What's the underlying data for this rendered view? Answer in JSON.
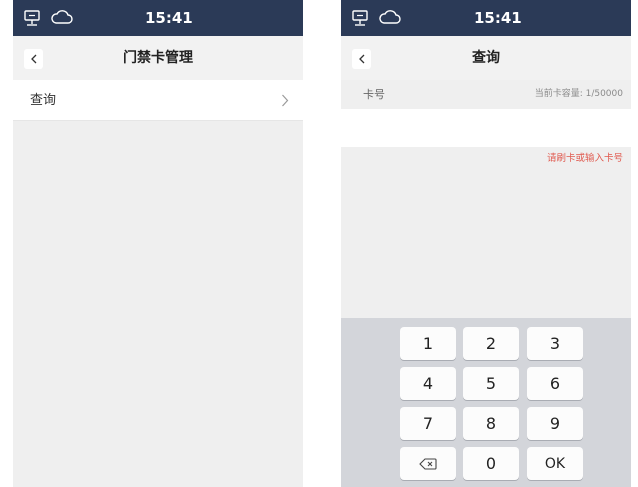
{
  "colors": {
    "status_bar": "#2b3a57",
    "background": "#efefef",
    "hint_red": "#e05a4f",
    "keypad_bg": "#d3d5da"
  },
  "status_icons": [
    "network-icon",
    "cloud-icon"
  ],
  "left_screen": {
    "time": "15:41",
    "title": "门禁卡管理",
    "items": [
      {
        "label": "查询",
        "icon": "chevron-right-icon"
      }
    ]
  },
  "right_screen": {
    "time": "15:41",
    "title": "查询",
    "field_label": "卡号",
    "capacity": "当前卡容量: 1/50000",
    "input_value": "",
    "hint": "请刷卡或输入卡号",
    "keypad": {
      "keys": [
        "1",
        "2",
        "3",
        "4",
        "5",
        "6",
        "7",
        "8",
        "9",
        "",
        "0",
        "OK"
      ],
      "backspace_icon": "backspace-icon"
    }
  }
}
